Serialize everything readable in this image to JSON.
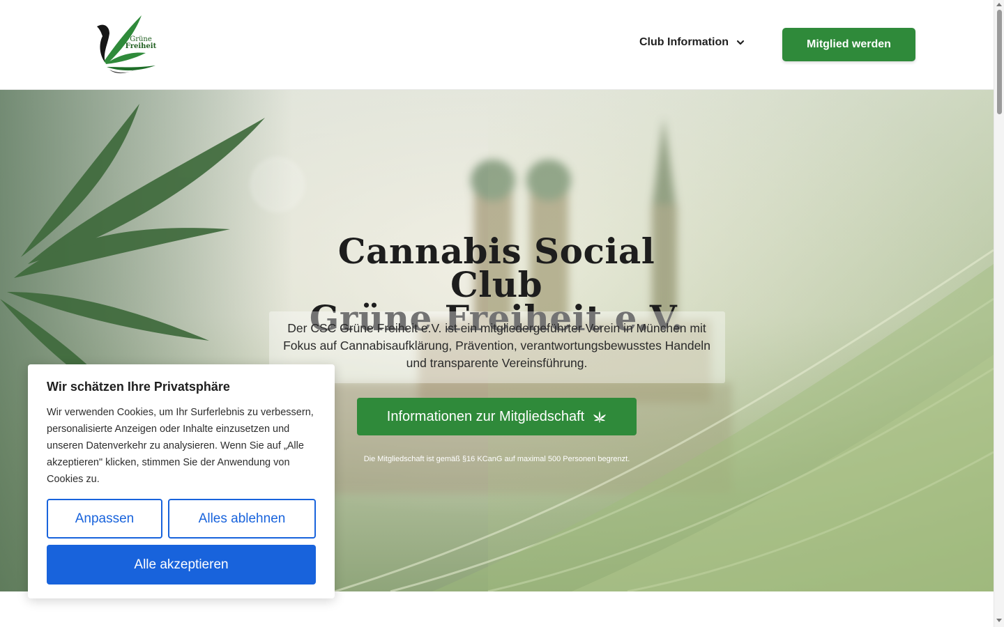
{
  "header": {
    "logo_text_line1": "Grüne",
    "logo_text_line2": "Freiheit",
    "nav_club_label": "Club Information",
    "member_button_label": "Mitglied werden"
  },
  "hero": {
    "title_line1": "Cannabis Social Club",
    "title_line2": "Grüne Freiheit e.V.",
    "description": "Der CSC Grüne Freiheit e.V. ist ein mitgliedergeführter Verein in München mit Fokus auf Cannabisaufklärung, Prävention, verantwortungsbewusstes Handeln und transparente Vereinsführung.",
    "info_button_label": "Informationen zur Mitgliedschaft",
    "note": "Die Mitgliedschaft ist gemäß §16 KCanG auf maximal 500 Personen begrenzt."
  },
  "cookie": {
    "title": "Wir schätzen Ihre Privatsphäre",
    "text": "Wir verwenden Cookies, um Ihr Surferlebnis zu verbessern, personalisierte Anzeigen oder Inhalte einzusetzen und unseren Datenverkehr zu analysieren. Wenn Sie auf „Alle akzeptieren\" klicken, stimmen Sie der Anwendung von Cookies zu.",
    "customize_label": "Anpassen",
    "reject_label": "Alles ablehnen",
    "accept_label": "Alle akzeptieren"
  },
  "colors": {
    "brand_green": "#2f8a3a",
    "cookie_blue": "#1863dc"
  },
  "icons": {
    "nav_dropdown": "chevron-down-icon",
    "info_button": "cannabis-leaf-icon"
  }
}
